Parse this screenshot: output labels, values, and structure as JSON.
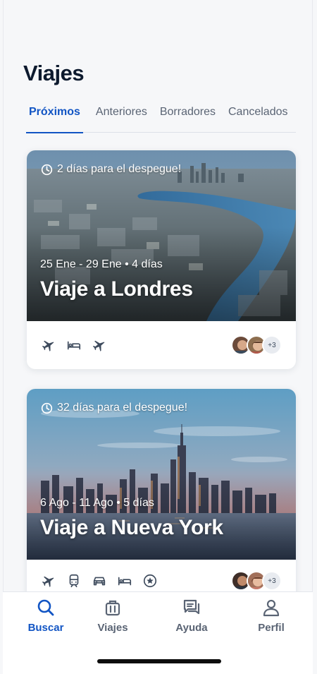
{
  "page": {
    "title": "Viajes"
  },
  "tabs": [
    {
      "label": "Próximos",
      "active": true
    },
    {
      "label": "Anteriores",
      "active": false
    },
    {
      "label": "Borradores",
      "active": false
    },
    {
      "label": "Cancelados",
      "active": false
    }
  ],
  "trips": [
    {
      "countdown": "2 días para el despegue!",
      "dates": "25 Ene - 29 Ene • 4 días",
      "name": "Viaje a Londres",
      "services": [
        "plane-icon",
        "bed-icon",
        "plane-icon"
      ],
      "extra_travelers": "+3"
    },
    {
      "countdown": "32 días para el despegue!",
      "dates": "6 Ago - 11 Ago • 5 días",
      "name": "Viaje a Nueva York",
      "services": [
        "plane-icon",
        "train-icon",
        "car-icon",
        "bed-icon",
        "star-icon"
      ],
      "extra_travelers": "+3"
    }
  ],
  "bottom_nav": [
    {
      "label": "Buscar",
      "icon": "search-icon",
      "active": true
    },
    {
      "label": "Viajes",
      "icon": "suitcase-icon",
      "active": false
    },
    {
      "label": "Ayuda",
      "icon": "chat-icon",
      "active": false
    },
    {
      "label": "Perfil",
      "icon": "user-icon",
      "active": false
    }
  ],
  "colors": {
    "accent": "#1255c4",
    "text": "#0d1a2e",
    "muted": "#5a6474"
  }
}
